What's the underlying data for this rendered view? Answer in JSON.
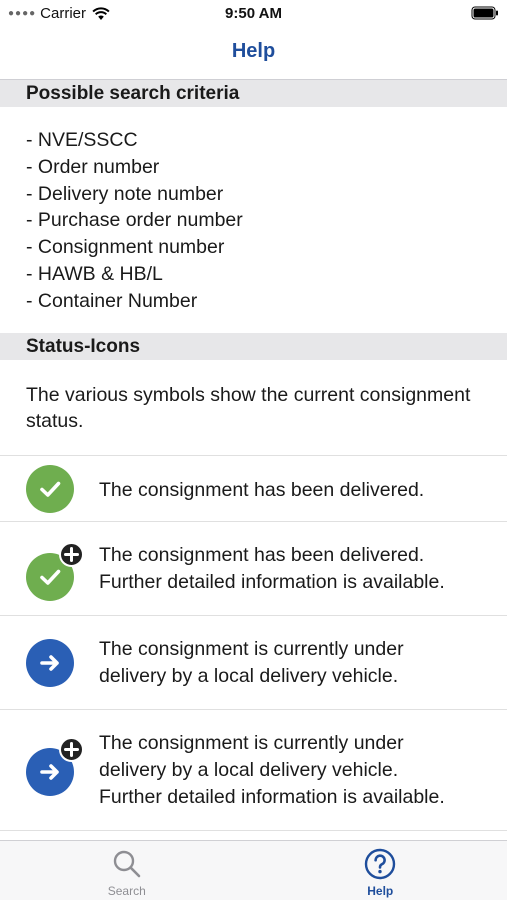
{
  "status_bar": {
    "carrier": "Carrier",
    "time": "9:50 AM"
  },
  "nav": {
    "title": "Help"
  },
  "sections": {
    "criteria_header": "Possible search criteria",
    "criteria_items": [
      "- NVE/SSCC",
      "- Order number",
      "- Delivery note number",
      "- Purchase order number",
      "- Consignment number",
      "- HAWB & HB/L",
      "- Container Number"
    ],
    "status_header": "Status-Icons",
    "status_intro": "The various symbols show the current consignment status.",
    "status_rows": [
      {
        "icon": "delivered-icon",
        "text": "The consignment has been delivered."
      },
      {
        "icon": "delivered-plus-icon",
        "text_line1": "The consignment has been delivered.",
        "text_line2": "Further detailed information is available."
      },
      {
        "icon": "in-delivery-icon",
        "text_line1": "The consignment is currently under",
        "text_line2": "delivery by a local delivery vehicle."
      },
      {
        "icon": "in-delivery-plus-icon",
        "text_line1": "The consignment is currently under",
        "text_line2": "delivery by a local delivery vehicle.",
        "text_line3": "Further detailed information is available."
      }
    ]
  },
  "tabs": {
    "search_label": "Search",
    "help_label": "Help"
  },
  "colors": {
    "accent": "#1f4e9c",
    "delivered": "#6fae4f",
    "in_delivery": "#2a5fb5"
  }
}
